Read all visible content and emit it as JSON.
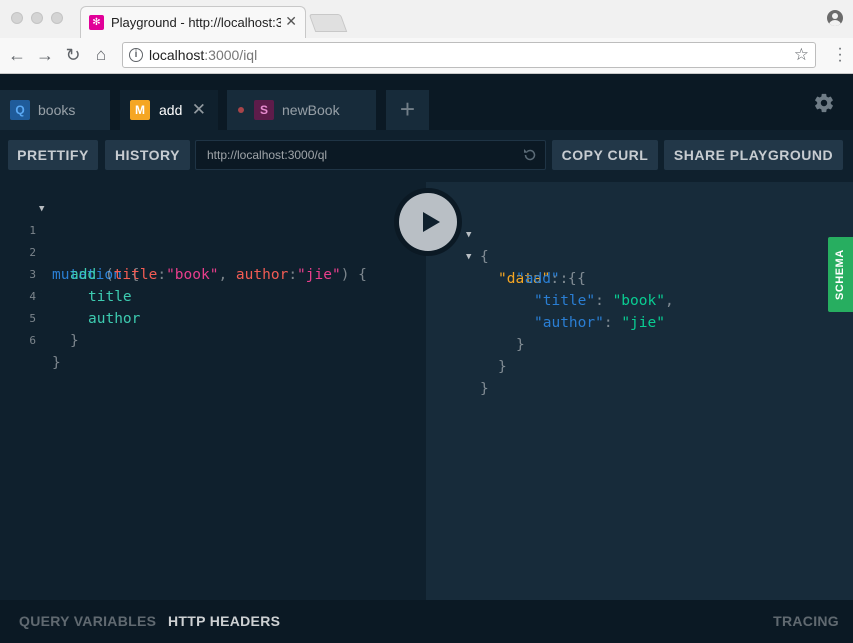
{
  "browser": {
    "tab_title": "Playground - http://localhost:3",
    "url_host": "localhost",
    "url_path": ":3000/iql"
  },
  "playground": {
    "tabs": [
      {
        "badge": "Q",
        "label": "books",
        "badge_color": "#1f5b9a",
        "badge_text_color": "#5aa9f5"
      },
      {
        "badge": "M",
        "label": "add",
        "badge_color": "#f5a623",
        "badge_text_color": "#ffffff"
      },
      {
        "badge": "S",
        "label": "newBook",
        "badge_color": "#5d1c4a",
        "badge_text_color": "#e88cd0"
      }
    ],
    "add_tab": "+",
    "toolbar": {
      "prettify": "PRETTIFY",
      "history": "HISTORY",
      "endpoint": "http://localhost:3000/ql",
      "copy_curl": "COPY CURL",
      "share": "SHARE PLAYGROUND"
    },
    "editor": {
      "line_numbers": [
        "1",
        "2",
        "3",
        "4",
        "5",
        "6"
      ],
      "mutation": "mutation",
      "open_brace": "{",
      "field": "add",
      "arg1_name": "title",
      "arg1_value": "\"book\"",
      "arg2_name": "author",
      "arg2_value": "\"jie\"",
      "sel1": "title",
      "sel2": "author",
      "close_brace": "}"
    },
    "result": {
      "data_key": "\"data\"",
      "add_key": "\"add\"",
      "title_key": "\"title\"",
      "title_value": "\"book\"",
      "author_key": "\"author\"",
      "author_value": "\"jie\""
    },
    "schema_label": "SCHEMA",
    "bottom": {
      "query_variables": "QUERY VARIABLES",
      "http_headers": "HTTP HEADERS",
      "tracing": "TRACING"
    }
  }
}
